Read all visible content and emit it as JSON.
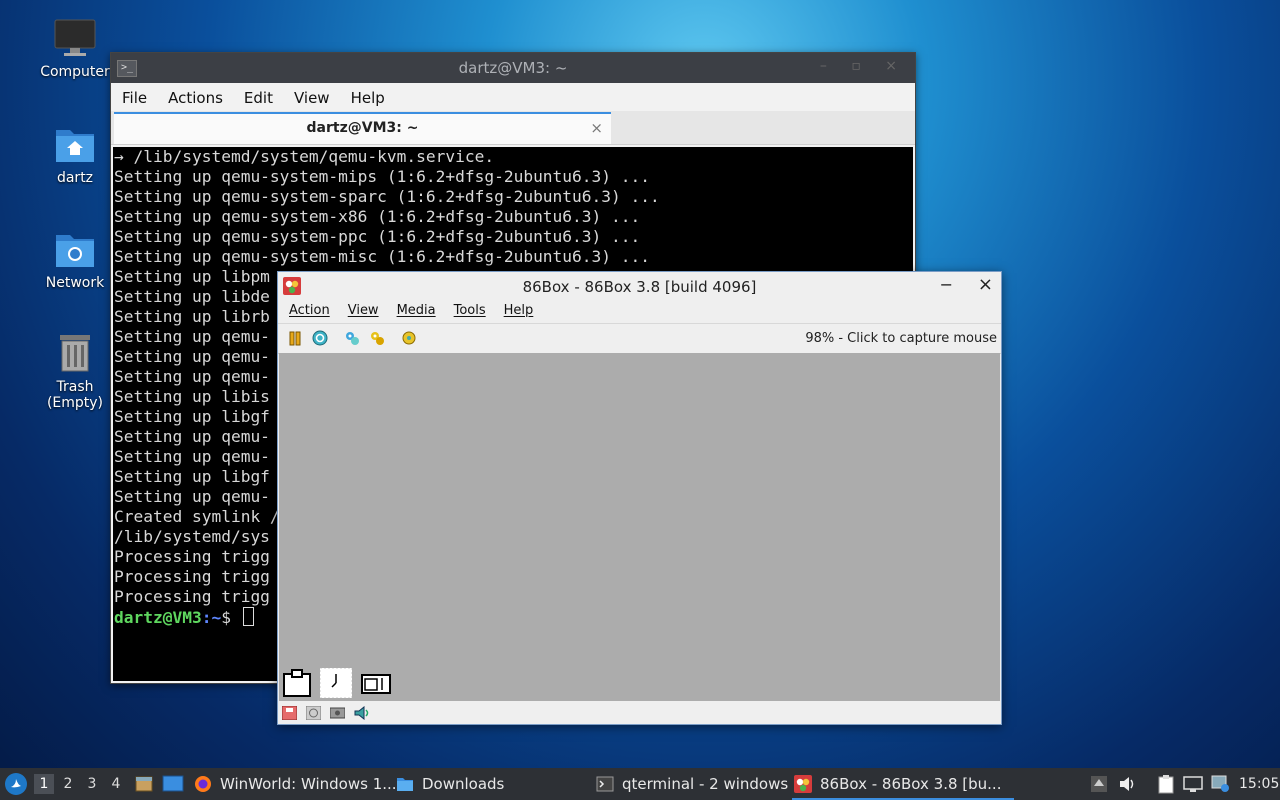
{
  "desktop": {
    "icons": [
      {
        "label": "Computer",
        "icon": "computer-icon"
      },
      {
        "label": "dartz",
        "icon": "home-folder-icon"
      },
      {
        "label": "Network",
        "icon": "network-folder-icon"
      },
      {
        "label": "Trash (Empty)",
        "icon": "trash-icon"
      }
    ]
  },
  "terminal": {
    "title": "dartz@VM3: ~",
    "menu": [
      "File",
      "Actions",
      "Edit",
      "View",
      "Help"
    ],
    "tab_label": "dartz@VM3: ~",
    "tab_close": "×",
    "lines": [
      "→ /lib/systemd/system/qemu-kvm.service.",
      "Setting up qemu-system-mips (1:6.2+dfsg-2ubuntu6.3) ...",
      "Setting up qemu-system-sparc (1:6.2+dfsg-2ubuntu6.3) ...",
      "Setting up qemu-system-x86 (1:6.2+dfsg-2ubuntu6.3) ...",
      "Setting up qemu-system-ppc (1:6.2+dfsg-2ubuntu6.3) ...",
      "Setting up qemu-system-misc (1:6.2+dfsg-2ubuntu6.3) ...",
      "Setting up libpm",
      "Setting up libde",
      "Setting up librb",
      "Setting up qemu-",
      "Setting up qemu-",
      "Setting up qemu-",
      "Setting up libis",
      "Setting up libgf",
      "Setting up qemu-",
      "Setting up qemu-",
      "Setting up libgf",
      "Setting up qemu-",
      "Created symlink /",
      "/lib/systemd/sys",
      "Processing trigg",
      "Processing trigg",
      "Processing trigg"
    ],
    "prompt_user": "dartz@VM3",
    "prompt_path": ":~",
    "prompt_symbol": "$ "
  },
  "box86": {
    "title": "86Box - 86Box 3.8 [build 4096]",
    "minimize": "−",
    "close": "×",
    "menu": [
      "Action",
      "View",
      "Media",
      "Tools",
      "Help"
    ],
    "toolbar_icons": [
      "pause-icon",
      "reset-icon",
      "settings-icon",
      "settings-alt-icon",
      "hardware-icon"
    ],
    "status_text": "98% - Click to capture mouse",
    "statusbar_icons": [
      "floppy-icon",
      "cdrom-icon",
      "hdd-icon",
      "sound-icon"
    ]
  },
  "taskbar": {
    "workspaces": [
      "1",
      "2",
      "3",
      "4"
    ],
    "active_workspace": "1",
    "tasks": [
      {
        "label": "WinWorld: Windows 1...",
        "icon": "firefox-icon"
      },
      {
        "label": "Downloads",
        "icon": "folder-icon"
      },
      {
        "label": "qterminal - 2 windows",
        "icon": "terminal-icon"
      },
      {
        "label": "86Box - 86Box 3.8 [bu...",
        "icon": "86box-icon"
      }
    ],
    "clock": "15:05"
  }
}
